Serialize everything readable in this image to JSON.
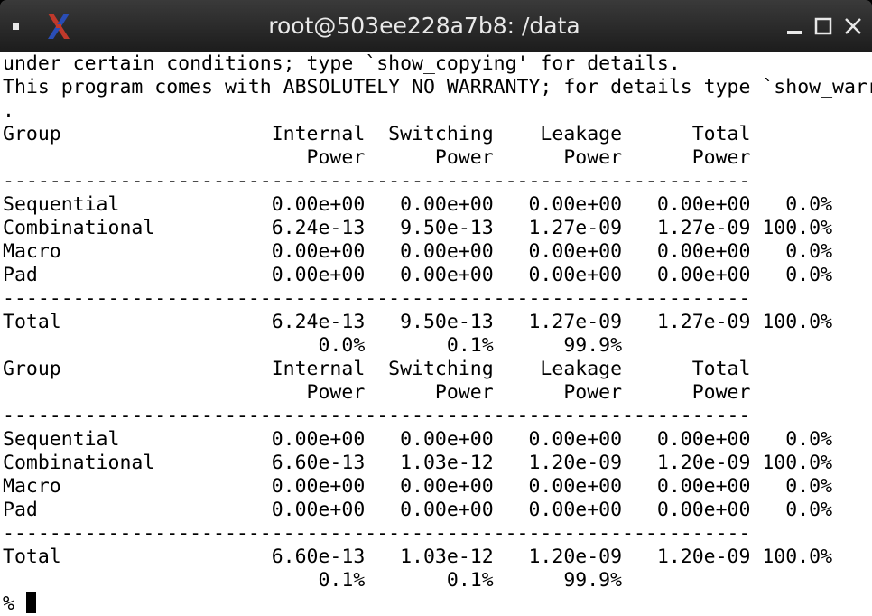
{
  "window": {
    "title": "root@503ee228a7b8: /data",
    "icons": [
      "window-menu-icon",
      "x-logo-icon",
      "minimize-icon",
      "maximize-icon",
      "close-icon"
    ]
  },
  "terminal": {
    "lines": [
      "under certain conditions; type `show_copying' for details.",
      "This program comes with ABSOLUTELY NO WARRANTY; for details type `show_warranty'",
      ".",
      "Group                  Internal  Switching    Leakage      Total",
      "                          Power      Power      Power      Power",
      "----------------------------------------------------------------",
      "Sequential             0.00e+00   0.00e+00   0.00e+00   0.00e+00   0.0%",
      "Combinational          6.24e-13   9.50e-13   1.27e-09   1.27e-09 100.0%",
      "Macro                  0.00e+00   0.00e+00   0.00e+00   0.00e+00   0.0%",
      "Pad                    0.00e+00   0.00e+00   0.00e+00   0.00e+00   0.0%",
      "----------------------------------------------------------------",
      "Total                  6.24e-13   9.50e-13   1.27e-09   1.27e-09 100.0%",
      "                           0.0%       0.1%      99.9%",
      "Group                  Internal  Switching    Leakage      Total",
      "                          Power      Power      Power      Power",
      "----------------------------------------------------------------",
      "Sequential             0.00e+00   0.00e+00   0.00e+00   0.00e+00   0.0%",
      "Combinational          6.60e-13   1.03e-12   1.20e-09   1.20e-09 100.0%",
      "Macro                  0.00e+00   0.00e+00   0.00e+00   0.00e+00   0.0%",
      "Pad                    0.00e+00   0.00e+00   0.00e+00   0.00e+00   0.0%",
      "----------------------------------------------------------------",
      "Total                  6.60e-13   1.03e-12   1.20e-09   1.20e-09 100.0%",
      "                           0.1%       0.1%      99.9%",
      "% "
    ]
  }
}
